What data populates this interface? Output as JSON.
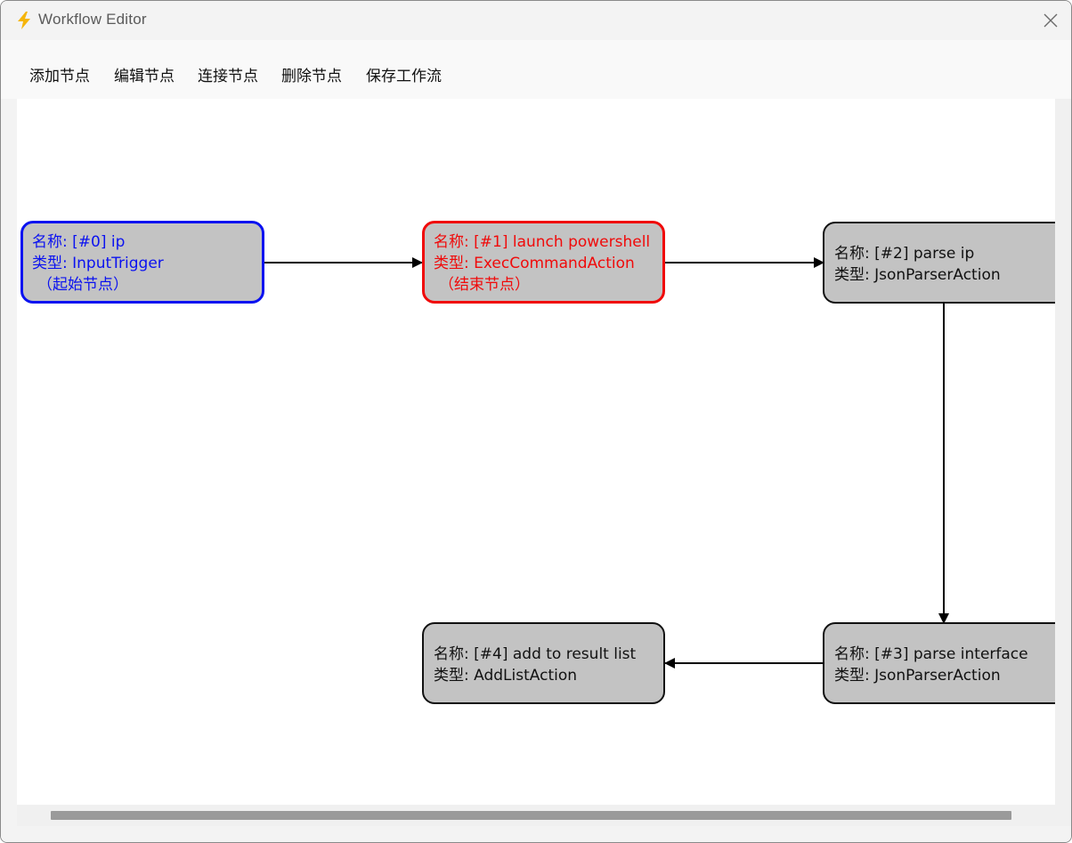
{
  "window": {
    "title": "Workflow Editor",
    "icon": "lightning-bolt-icon"
  },
  "menu": {
    "items": [
      "添加节点",
      "编辑节点",
      "连接节点",
      "删除节点",
      "保存工作流"
    ]
  },
  "nodes": [
    {
      "label_name": "名称: [#0] ip",
      "label_type": "类型: InputTrigger",
      "tag": "（起始节点）",
      "role": "start",
      "color": "#0b12f0"
    },
    {
      "label_name": "名称: [#1] launch powershell",
      "label_type": "类型: ExecCommandAction",
      "tag": "（结束节点）",
      "role": "end",
      "color": "#f00a0a"
    },
    {
      "label_name": "名称: [#2] parse ip",
      "label_type": "类型: JsonParserAction",
      "role": "normal",
      "color": "#111111"
    },
    {
      "label_name": "名称: [#3] parse interface",
      "label_type": "类型: JsonParserAction",
      "role": "normal",
      "color": "#111111"
    },
    {
      "label_name": "名称: [#4] add to result list",
      "label_type": "类型: AddListAction",
      "role": "normal",
      "color": "#111111"
    }
  ],
  "edges": [
    {
      "from": 0,
      "to": 1
    },
    {
      "from": 1,
      "to": 2
    },
    {
      "from": 2,
      "to": 3
    },
    {
      "from": 3,
      "to": 4
    }
  ],
  "colors": {
    "node_fill": "#c3c3c3",
    "start_border": "#0b12f0",
    "end_border": "#f00a0a"
  }
}
